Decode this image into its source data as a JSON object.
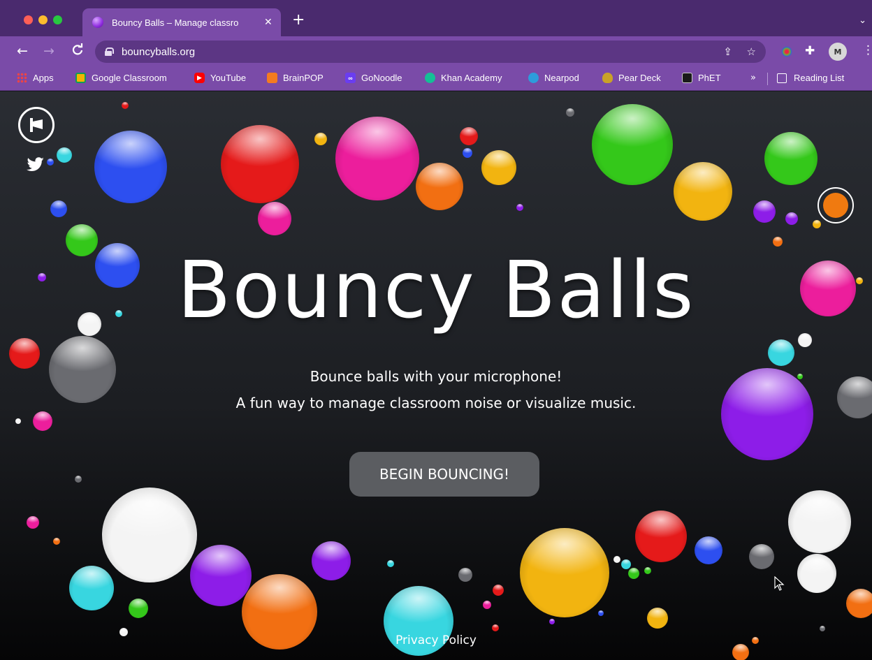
{
  "browser": {
    "tab_title": "Bouncy Balls – Manage classro",
    "new_tab": "+",
    "tab_close": "✕",
    "url": "bouncyballs.org",
    "profile_initials": "M"
  },
  "bookmarks": [
    {
      "label": "Apps",
      "icon": "apps-grid-icon"
    },
    {
      "label": "Google Classroom",
      "icon": "google-classroom-icon"
    },
    {
      "label": "YouTube",
      "icon": "youtube-icon"
    },
    {
      "label": "BrainPOP",
      "icon": "brainpop-icon"
    },
    {
      "label": "GoNoodle",
      "icon": "gonoodle-icon"
    },
    {
      "label": "Khan Academy",
      "icon": "khan-academy-icon"
    },
    {
      "label": "Nearpod",
      "icon": "nearpod-icon"
    },
    {
      "label": "Pear Deck",
      "icon": "pear-deck-icon"
    },
    {
      "label": "PhET",
      "icon": "phet-icon"
    }
  ],
  "bookmarks_overflow": "»",
  "reading_list": "Reading List",
  "page": {
    "title": "Bouncy Balls",
    "subtitle_1": "Bounce balls with your microphone!",
    "subtitle_2": "A fun way to manage classroom noise or visualize music.",
    "cta": "BEGIN BOUNCING!",
    "privacy": "Privacy Policy",
    "settings_accent": "#f07a10"
  },
  "ball_colors": {
    "blue": "#2d4ff0",
    "red": "#e51a1a",
    "pink": "#ec1e9c",
    "orange": "#f26f12",
    "yellow": "#f2b410",
    "green": "#34c81a",
    "purple": "#8d1de8",
    "cyan": "#38d6e0",
    "white": "#f4f4f4",
    "gray": "#6a6b70"
  }
}
